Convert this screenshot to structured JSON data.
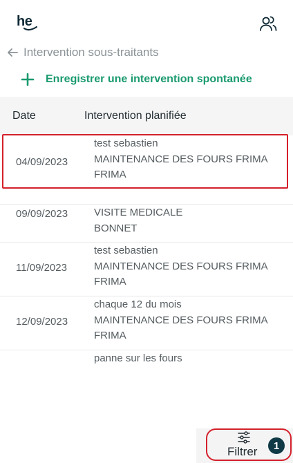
{
  "header": {
    "logo_text": "he",
    "users_icon": "users-icon"
  },
  "breadcrumb": {
    "back_icon": "arrow-left-icon",
    "title": "Intervention sous-traitants"
  },
  "actions": {
    "new_intervention_label": "Enregistrer une intervention spontanée",
    "plus_icon": "plus-icon",
    "accent": "#1a9a6e"
  },
  "table": {
    "columns": [
      "Date",
      "Intervention planifiée"
    ],
    "rows": [
      {
        "date": "04/09/2023",
        "lines": [
          "test sebastien",
          "MAINTENANCE DES FOURS FRIMA",
          "FRIMA"
        ]
      },
      {
        "date": "09/09/2023",
        "lines": [
          "VISITE MEDICALE",
          "BONNET"
        ]
      },
      {
        "date": "11/09/2023",
        "lines": [
          "test sebastien",
          "MAINTENANCE DES FOURS FRIMA",
          "FRIMA"
        ]
      },
      {
        "date": "12/09/2023",
        "lines": [
          "chaque 12 du mois",
          "MAINTENANCE DES FOURS FRIMA",
          "FRIMA"
        ]
      },
      {
        "date": "",
        "lines": [
          "panne sur les fours"
        ]
      }
    ]
  },
  "filter": {
    "label": "Filtrer",
    "icon": "sliders-icon",
    "badge_count": "1",
    "badge_color": "#0f3a46"
  },
  "highlight_color": "#d4202a"
}
